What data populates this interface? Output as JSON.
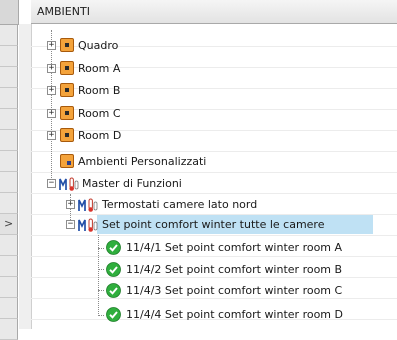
{
  "column_header": "AMBIENTI",
  "tree": {
    "rooms": [
      {
        "label": "Quadro"
      },
      {
        "label": "Room A"
      },
      {
        "label": "Room B"
      },
      {
        "label": "Room C"
      },
      {
        "label": "Room D"
      }
    ],
    "custom_rooms": {
      "label": "Ambienti Personalizzati"
    },
    "master": {
      "label": "Master di Funzioni",
      "thermostats": {
        "label": "Termostati camere lato nord"
      },
      "setpoint_group": {
        "label": "Set point comfort winter tutte le camere",
        "items": [
          {
            "label": "11/4/1 Set point comfort winter room A"
          },
          {
            "label": "11/4/2 Set point comfort winter room B"
          },
          {
            "label": "11/4/3 Set point comfort winter room C"
          },
          {
            "label": "11/4/4 Set point comfort winter room D"
          }
        ]
      }
    }
  },
  "expander_symbols": {
    "plus": "+",
    "minus": "−"
  },
  "current_row_marker": ">",
  "colors": {
    "selection": "#bfe1f4",
    "room_icon": "#f4a33b",
    "ok_icon": "#2fae3d"
  }
}
